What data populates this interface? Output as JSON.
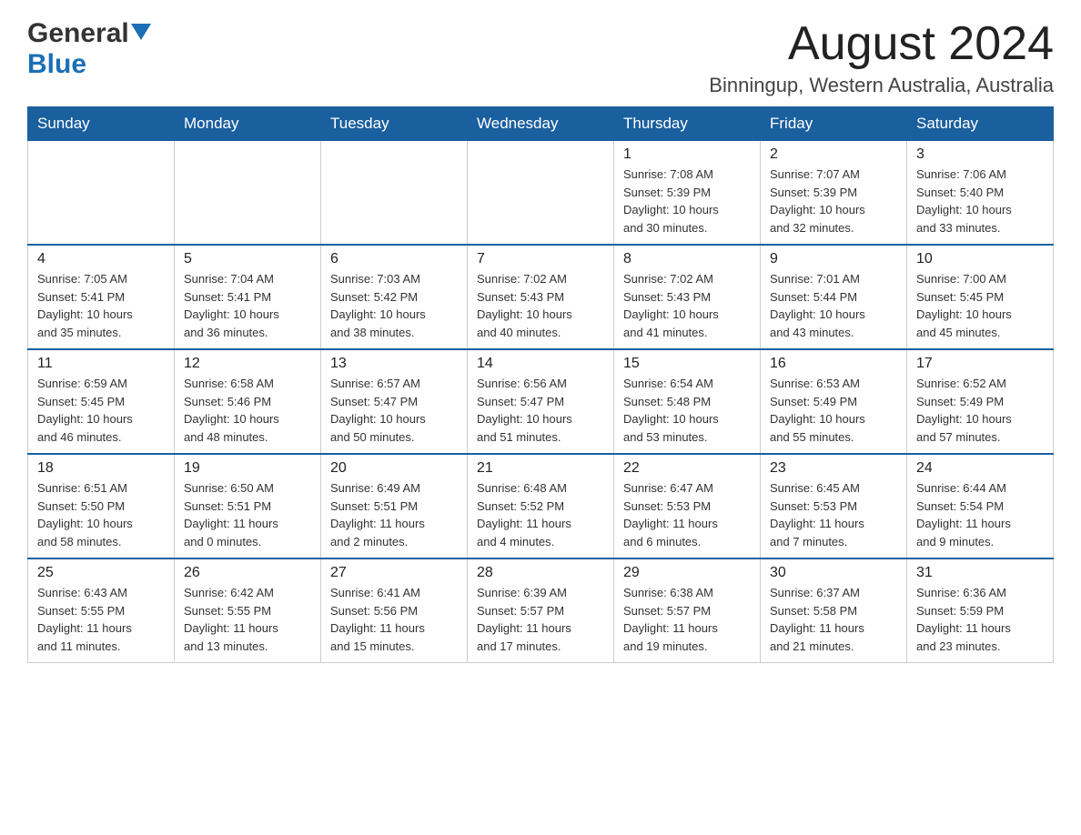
{
  "header": {
    "month_title": "August 2024",
    "location": "Binningup, Western Australia, Australia"
  },
  "logo": {
    "line1": "General",
    "line2": "Blue"
  },
  "weekdays": [
    "Sunday",
    "Monday",
    "Tuesday",
    "Wednesday",
    "Thursday",
    "Friday",
    "Saturday"
  ],
  "weeks": [
    [
      {
        "day": "",
        "info": ""
      },
      {
        "day": "",
        "info": ""
      },
      {
        "day": "",
        "info": ""
      },
      {
        "day": "",
        "info": ""
      },
      {
        "day": "1",
        "info": "Sunrise: 7:08 AM\nSunset: 5:39 PM\nDaylight: 10 hours\nand 30 minutes."
      },
      {
        "day": "2",
        "info": "Sunrise: 7:07 AM\nSunset: 5:39 PM\nDaylight: 10 hours\nand 32 minutes."
      },
      {
        "day": "3",
        "info": "Sunrise: 7:06 AM\nSunset: 5:40 PM\nDaylight: 10 hours\nand 33 minutes."
      }
    ],
    [
      {
        "day": "4",
        "info": "Sunrise: 7:05 AM\nSunset: 5:41 PM\nDaylight: 10 hours\nand 35 minutes."
      },
      {
        "day": "5",
        "info": "Sunrise: 7:04 AM\nSunset: 5:41 PM\nDaylight: 10 hours\nand 36 minutes."
      },
      {
        "day": "6",
        "info": "Sunrise: 7:03 AM\nSunset: 5:42 PM\nDaylight: 10 hours\nand 38 minutes."
      },
      {
        "day": "7",
        "info": "Sunrise: 7:02 AM\nSunset: 5:43 PM\nDaylight: 10 hours\nand 40 minutes."
      },
      {
        "day": "8",
        "info": "Sunrise: 7:02 AM\nSunset: 5:43 PM\nDaylight: 10 hours\nand 41 minutes."
      },
      {
        "day": "9",
        "info": "Sunrise: 7:01 AM\nSunset: 5:44 PM\nDaylight: 10 hours\nand 43 minutes."
      },
      {
        "day": "10",
        "info": "Sunrise: 7:00 AM\nSunset: 5:45 PM\nDaylight: 10 hours\nand 45 minutes."
      }
    ],
    [
      {
        "day": "11",
        "info": "Sunrise: 6:59 AM\nSunset: 5:45 PM\nDaylight: 10 hours\nand 46 minutes."
      },
      {
        "day": "12",
        "info": "Sunrise: 6:58 AM\nSunset: 5:46 PM\nDaylight: 10 hours\nand 48 minutes."
      },
      {
        "day": "13",
        "info": "Sunrise: 6:57 AM\nSunset: 5:47 PM\nDaylight: 10 hours\nand 50 minutes."
      },
      {
        "day": "14",
        "info": "Sunrise: 6:56 AM\nSunset: 5:47 PM\nDaylight: 10 hours\nand 51 minutes."
      },
      {
        "day": "15",
        "info": "Sunrise: 6:54 AM\nSunset: 5:48 PM\nDaylight: 10 hours\nand 53 minutes."
      },
      {
        "day": "16",
        "info": "Sunrise: 6:53 AM\nSunset: 5:49 PM\nDaylight: 10 hours\nand 55 minutes."
      },
      {
        "day": "17",
        "info": "Sunrise: 6:52 AM\nSunset: 5:49 PM\nDaylight: 10 hours\nand 57 minutes."
      }
    ],
    [
      {
        "day": "18",
        "info": "Sunrise: 6:51 AM\nSunset: 5:50 PM\nDaylight: 10 hours\nand 58 minutes."
      },
      {
        "day": "19",
        "info": "Sunrise: 6:50 AM\nSunset: 5:51 PM\nDaylight: 11 hours\nand 0 minutes."
      },
      {
        "day": "20",
        "info": "Sunrise: 6:49 AM\nSunset: 5:51 PM\nDaylight: 11 hours\nand 2 minutes."
      },
      {
        "day": "21",
        "info": "Sunrise: 6:48 AM\nSunset: 5:52 PM\nDaylight: 11 hours\nand 4 minutes."
      },
      {
        "day": "22",
        "info": "Sunrise: 6:47 AM\nSunset: 5:53 PM\nDaylight: 11 hours\nand 6 minutes."
      },
      {
        "day": "23",
        "info": "Sunrise: 6:45 AM\nSunset: 5:53 PM\nDaylight: 11 hours\nand 7 minutes."
      },
      {
        "day": "24",
        "info": "Sunrise: 6:44 AM\nSunset: 5:54 PM\nDaylight: 11 hours\nand 9 minutes."
      }
    ],
    [
      {
        "day": "25",
        "info": "Sunrise: 6:43 AM\nSunset: 5:55 PM\nDaylight: 11 hours\nand 11 minutes."
      },
      {
        "day": "26",
        "info": "Sunrise: 6:42 AM\nSunset: 5:55 PM\nDaylight: 11 hours\nand 13 minutes."
      },
      {
        "day": "27",
        "info": "Sunrise: 6:41 AM\nSunset: 5:56 PM\nDaylight: 11 hours\nand 15 minutes."
      },
      {
        "day": "28",
        "info": "Sunrise: 6:39 AM\nSunset: 5:57 PM\nDaylight: 11 hours\nand 17 minutes."
      },
      {
        "day": "29",
        "info": "Sunrise: 6:38 AM\nSunset: 5:57 PM\nDaylight: 11 hours\nand 19 minutes."
      },
      {
        "day": "30",
        "info": "Sunrise: 6:37 AM\nSunset: 5:58 PM\nDaylight: 11 hours\nand 21 minutes."
      },
      {
        "day": "31",
        "info": "Sunrise: 6:36 AM\nSunset: 5:59 PM\nDaylight: 11 hours\nand 23 minutes."
      }
    ]
  ]
}
